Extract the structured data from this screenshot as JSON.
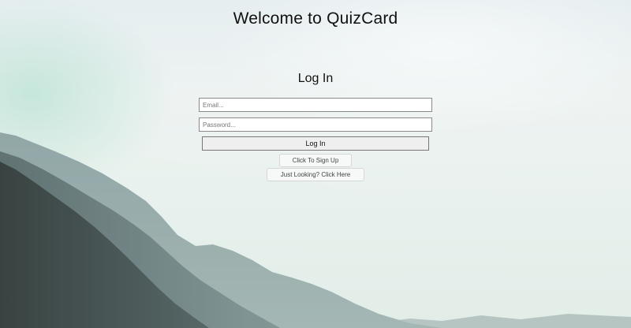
{
  "header": {
    "title": "Welcome to QuizCard"
  },
  "login": {
    "heading": "Log In",
    "email_placeholder": "Email...",
    "password_placeholder": "Password...",
    "submit_label": "Log In",
    "signup_label": "Click To Sign Up",
    "guest_label": "Just Looking? Click Here"
  },
  "colors": {
    "sky_light": "#eef3f2",
    "mountain_near": "#2f3a3a",
    "mountain_far": "#7c9294"
  }
}
